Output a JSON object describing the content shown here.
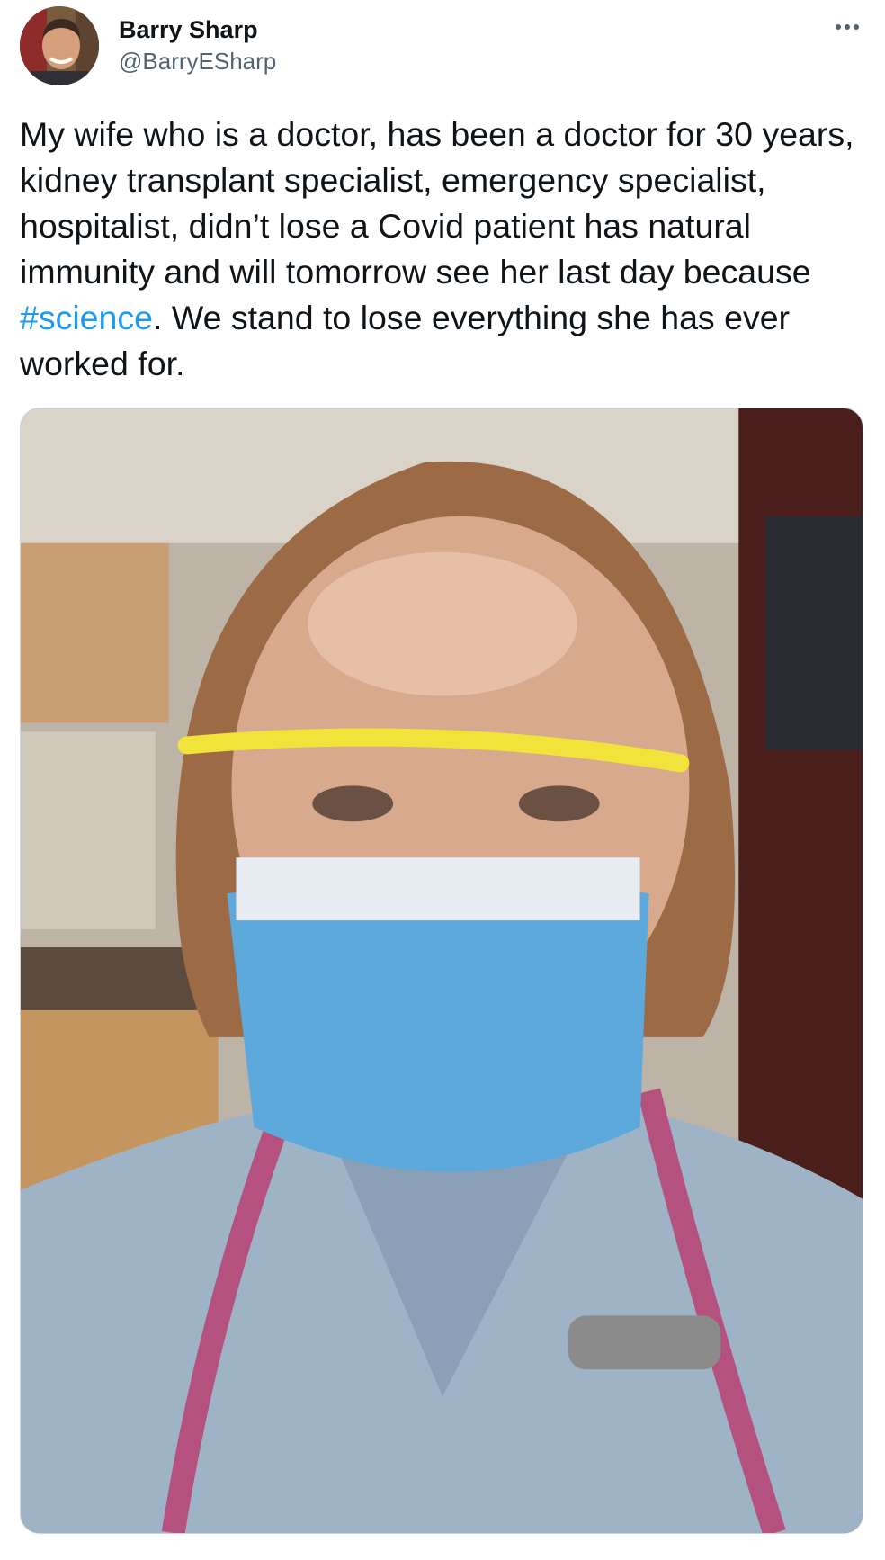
{
  "tweet": {
    "author_name": "Barry Sharp",
    "author_handle": "@BarryESharp",
    "text_before": "My wife who is a doctor, has been a doctor for 30 years, kidney transplant specialist, emergency specialist, hospitalist, didn’t lose a Covid patient has natural immunity and will tomorrow see her last day because ",
    "hashtag": "#science",
    "text_after": ". We stand to lose everything she has ever worked for.",
    "more_icon": "more-horizontal-icon"
  },
  "colors": {
    "hashtag": "#1d9bf0",
    "text": "#0f1419",
    "secondary": "#536471"
  }
}
